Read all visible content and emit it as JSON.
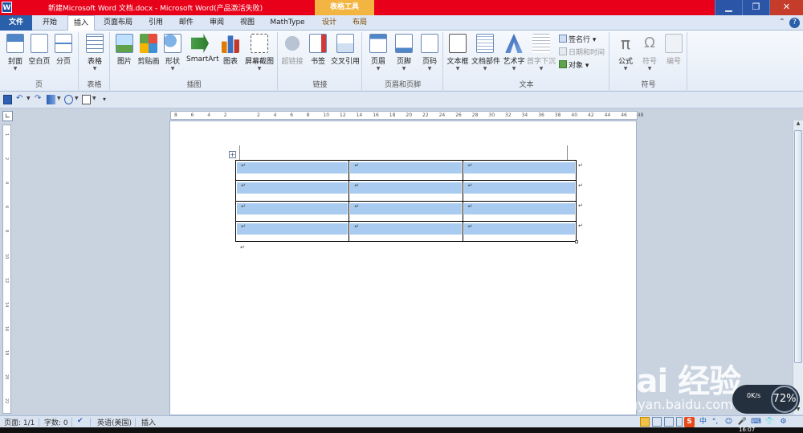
{
  "title_bar": {
    "app_icon": "W",
    "document_title": "新建Microsoft Word 文档.docx  -  Microsoft Word(产品激活失败)",
    "context_tab_group": "表格工具",
    "controls": {
      "minimize": "▁",
      "restore": "❐",
      "close": "✕"
    }
  },
  "tabs": [
    "文件",
    "开始",
    "插入",
    "页面布局",
    "引用",
    "邮件",
    "审阅",
    "视图",
    "MathType",
    "设计",
    "布局"
  ],
  "active_tab": "插入",
  "help": "?",
  "ribbon_groups": {
    "pages": {
      "label": "页",
      "buttons": [
        "封面",
        "空白页",
        "分页"
      ]
    },
    "tables": {
      "label": "表格",
      "buttons": [
        "表格"
      ]
    },
    "illustrations": {
      "label": "插图",
      "buttons": [
        "图片",
        "剪贴画",
        "形状",
        "SmartArt",
        "图表",
        "屏幕截图"
      ]
    },
    "links": {
      "label": "链接",
      "buttons": [
        "超链接",
        "书签",
        "交叉引用"
      ]
    },
    "header_footer": {
      "label": "页眉和页脚",
      "buttons": [
        "页眉",
        "页脚",
        "页码"
      ]
    },
    "text": {
      "label": "文本",
      "buttons": [
        "文本框",
        "文档部件",
        "艺术字",
        "首字下沉"
      ],
      "small_buttons": [
        "签名行",
        "日期和时间",
        "对象"
      ]
    },
    "symbols": {
      "label": "符号",
      "buttons": [
        "公式",
        "符号",
        "编号"
      ]
    }
  },
  "ruler": {
    "ticks": [
      "8",
      "6",
      "4",
      "2",
      "",
      "2",
      "4",
      "6",
      "8",
      "10",
      "12",
      "14",
      "16",
      "18",
      "20",
      "22",
      "24",
      "26",
      "28",
      "30",
      "32",
      "34",
      "36",
      "38",
      "40",
      "42",
      "44",
      "46",
      "48"
    ]
  },
  "vertical_ruler": {
    "ticks": [
      "1",
      "2",
      "4",
      "6",
      "8",
      "10",
      "12",
      "14",
      "16",
      "18",
      "20",
      "22"
    ]
  },
  "document": {
    "table": {
      "rows": 4,
      "cols": 3,
      "cell_mark": "↵"
    },
    "paragraph_mark": "↵"
  },
  "watermark": {
    "logo": "Bai 经验",
    "url": "jingyan.baidu.com"
  },
  "network_widget": {
    "speed": "0K/s",
    "percent": "72%"
  },
  "status_bar": {
    "page": "页面: 1/1",
    "word_count": "字数: 0",
    "language": "英语(美国)",
    "mode": "插入"
  },
  "tray": [
    "中",
    "°,",
    "☺",
    "🎤",
    "⌨",
    "👕",
    "⚙"
  ],
  "clock": "16:07",
  "colors": {
    "title_bar": "#e8001a",
    "context_tab": "#f2b541",
    "file_tab": "#2a5faa",
    "cell_highlight": "#a9cbef"
  }
}
